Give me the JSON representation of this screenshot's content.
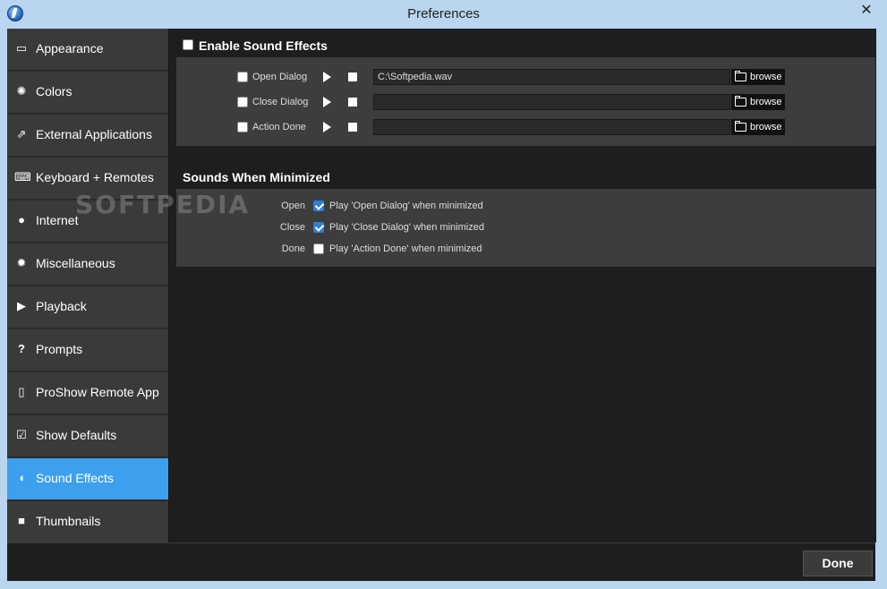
{
  "window": {
    "title": "Preferences",
    "close_glyph": "✕"
  },
  "sidebar": {
    "items": [
      {
        "label": "Appearance",
        "icon": "window-icon",
        "glyph": "▭",
        "active": false
      },
      {
        "label": "Colors",
        "icon": "palette-icon",
        "glyph": "✺",
        "active": false
      },
      {
        "label": "External Applications",
        "icon": "external-link-icon",
        "glyph": "⇗",
        "active": false
      },
      {
        "label": "Keyboard + Remotes",
        "icon": "keyboard-icon",
        "glyph": "⌨",
        "active": false
      },
      {
        "label": "Internet",
        "icon": "globe-icon",
        "glyph": "●",
        "active": false
      },
      {
        "label": "Miscellaneous",
        "icon": "gear-icon",
        "glyph": "✹",
        "active": false
      },
      {
        "label": "Playback",
        "icon": "play-icon",
        "glyph": "▶",
        "active": false
      },
      {
        "label": "Prompts",
        "icon": "question-icon",
        "glyph": "?",
        "active": false
      },
      {
        "label": "ProShow Remote App",
        "icon": "remote-icon",
        "glyph": "▯",
        "active": false
      },
      {
        "label": "Show Defaults",
        "icon": "checkbox-icon",
        "glyph": "☑",
        "active": false
      },
      {
        "label": "Sound Effects",
        "icon": "speaker-icon",
        "glyph": "◖",
        "active": true
      },
      {
        "label": "Thumbnails",
        "icon": "thumbnail-icon",
        "glyph": "■",
        "active": false
      }
    ]
  },
  "sound_effects": {
    "enable_label": "Enable Sound Effects",
    "enable_checked": false,
    "rows": [
      {
        "label": "Open Dialog",
        "checked": false,
        "path": "C:\\Softpedia.wav",
        "browse": "browse"
      },
      {
        "label": "Close Dialog",
        "checked": false,
        "path": "",
        "browse": "browse"
      },
      {
        "label": "Action Done",
        "checked": false,
        "path": "",
        "browse": "browse"
      }
    ]
  },
  "minimized": {
    "title": "Sounds When Minimized",
    "rows": [
      {
        "label": "Open",
        "checked": true,
        "text": "Play 'Open Dialog' when minimized"
      },
      {
        "label": "Close",
        "checked": true,
        "text": "Play 'Close Dialog' when minimized"
      },
      {
        "label": "Done",
        "checked": false,
        "text": "Play 'Action Done' when minimized"
      }
    ]
  },
  "footer": {
    "done_label": "Done"
  },
  "watermark": "SOFTPEDIA",
  "colors": {
    "active_nav": "#3da0ee",
    "checkbox_checked": "#2f7fd6"
  }
}
